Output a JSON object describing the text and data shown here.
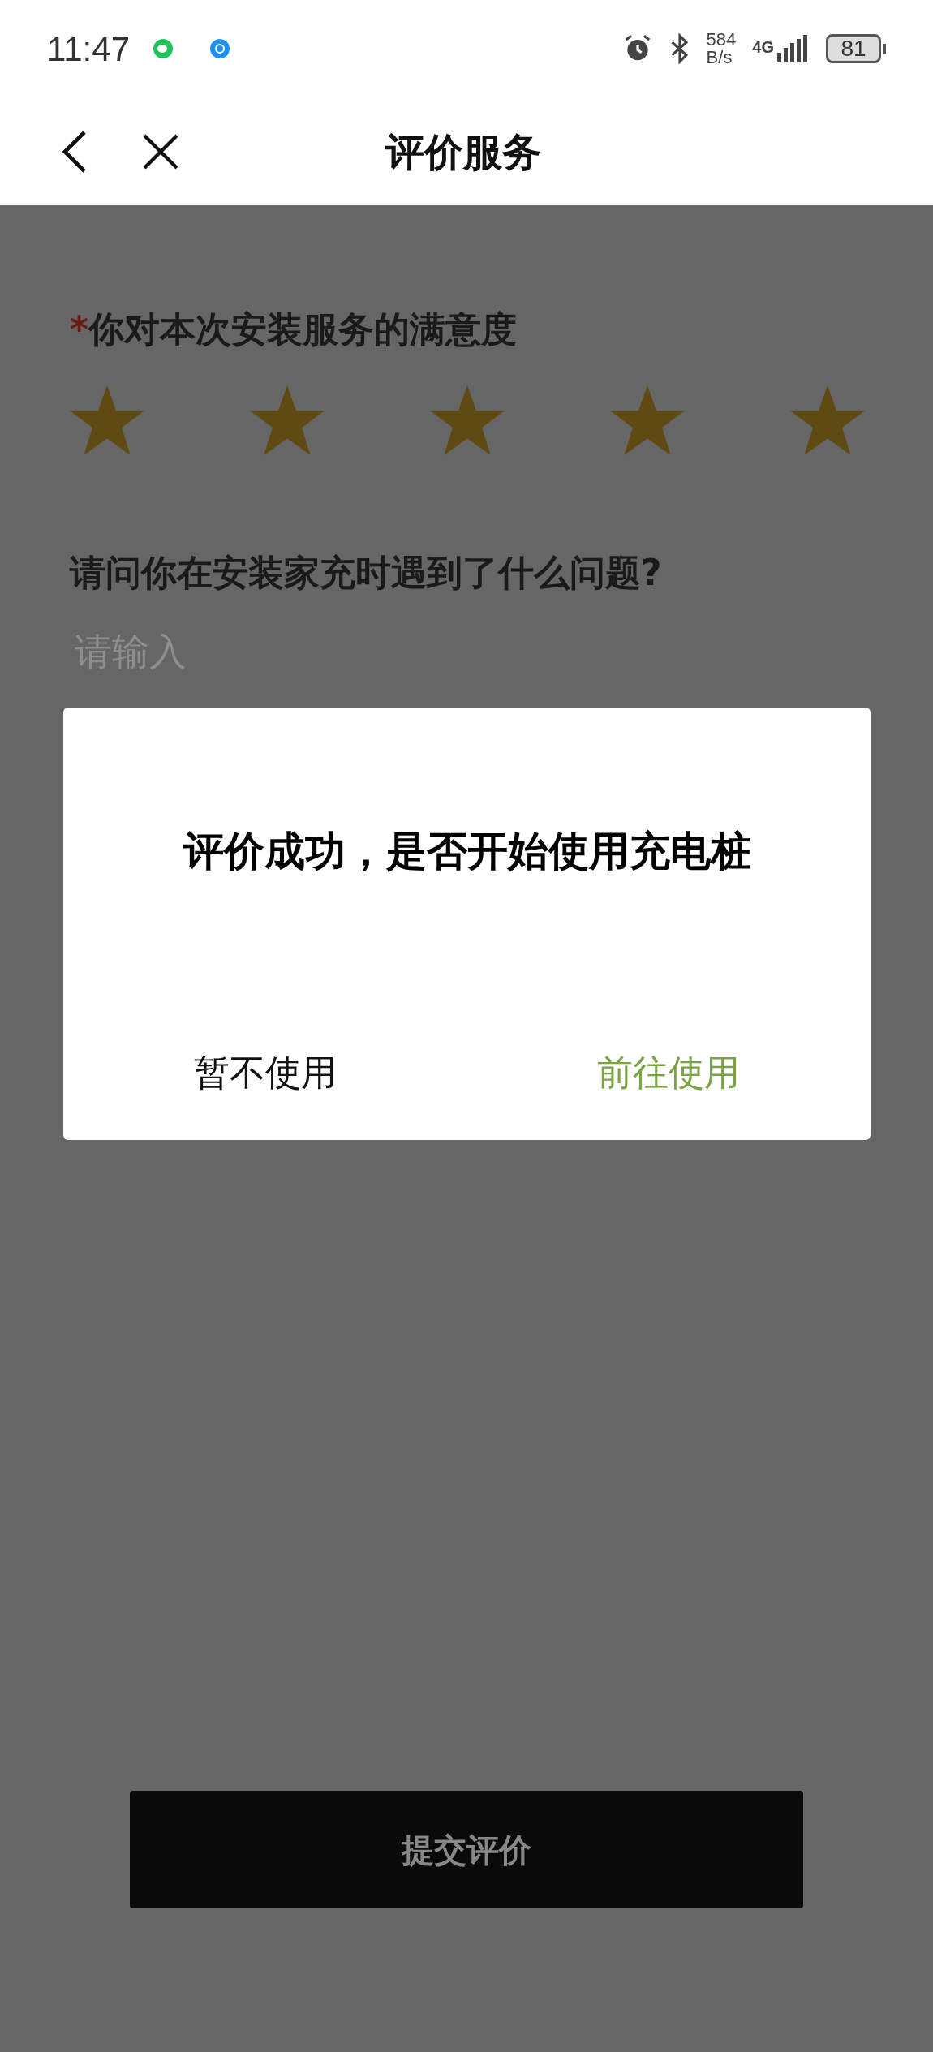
{
  "status_bar": {
    "time": "11:47",
    "speed_value": "584",
    "speed_unit": "B/s",
    "network": "4G",
    "battery": "81"
  },
  "header": {
    "title": "评价服务"
  },
  "form": {
    "rating_label": "你对本次安装服务的满意度",
    "required_mark": "*",
    "stars": 5,
    "question": "请问你在安装家充时遇到了什么问题?",
    "placeholder": "请输入"
  },
  "submit_button": "提交评价",
  "dialog": {
    "title": "评价成功，是否开始使用充电桩",
    "buttons": [
      {
        "label": "暂不使用",
        "kind": "secondary"
      },
      {
        "label": "前往使用",
        "kind": "primary"
      }
    ]
  }
}
